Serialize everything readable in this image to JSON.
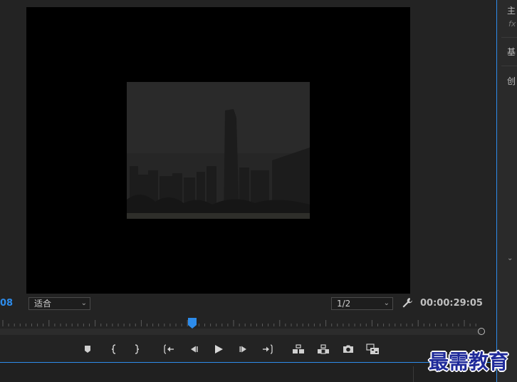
{
  "monitor": {
    "timecode_in": "08",
    "timecode_out": "00:00:29:05",
    "zoom": {
      "selected": "适合"
    },
    "resolution": {
      "selected": "1/2"
    },
    "playhead_fraction": 0.4
  },
  "right_panel": {
    "tab_main": "主",
    "fx_label": "fx",
    "tab_basic": "基",
    "tab_create": "创"
  },
  "watermark": "最需教育",
  "icons": {
    "add_marker": "marker-icon",
    "mark_in": "mark-in-icon",
    "mark_out": "mark-out-icon",
    "go_to_in": "go-to-in-icon",
    "step_back": "step-back-icon",
    "play": "play-icon",
    "step_forward": "step-forward-icon",
    "go_to_out": "go-to-out-icon",
    "insert": "insert-icon",
    "overwrite": "overwrite-icon",
    "export_frame": "camera-icon",
    "compare": "compare-icon",
    "settings": "wrench-icon"
  },
  "colors": {
    "accent": "#2d8ceb",
    "background": "#232323",
    "canvas": "#000000"
  }
}
